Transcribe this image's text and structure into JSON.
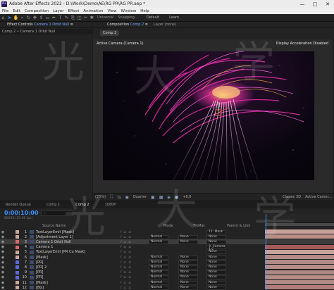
{
  "window": {
    "title": "Adobe After Effects 2022 - D:\\Work\\Demo\\AE\\RG PR\\RG PR.aep *",
    "app_icon": "Ae",
    "controls": [
      "—",
      "□",
      "✕"
    ]
  },
  "menu": [
    "File",
    "Edit",
    "Composition",
    "Layer",
    "Effect",
    "Animation",
    "View",
    "Window",
    "Help"
  ],
  "toolbar": {
    "tools": [
      "home-icon",
      "select-icon",
      "hand-icon",
      "zoom-icon",
      "orbit-icon",
      "pan-icon",
      "dolly-icon",
      "rectangle-icon",
      "pen-icon",
      "text-icon",
      "brush-icon",
      "clone-icon",
      "eraser-icon",
      "roto-icon",
      "puppet-icon"
    ],
    "universal_label": "Universal",
    "snapping_label": "Snapping",
    "workspaces": [
      "Default",
      "Learn"
    ]
  },
  "left_panel": {
    "tab_prefix": "Effect Controls",
    "tab_layer": "Camera 1 Orbit Null",
    "tab_menu": "≡",
    "header": "Comp 2 • Camera 1 Orbit Null"
  },
  "comp_panel": {
    "tab": "Composition",
    "tab_comp": "Comp 2",
    "tab_menu": "≡",
    "layer_tab": "Layer  (none)",
    "subtab": "Comp 2",
    "active_camera": "Active Camera (Camera 1)",
    "display_accel": "Display Acceleration Disabled"
  },
  "viewer_bar": {
    "zoom": "(25%)",
    "resolution": "Quarter",
    "plus_value": "+0.0",
    "renderer": "Classic 3D",
    "view": "Active Camer..."
  },
  "timeline": {
    "tabs": [
      "Render Queue",
      "Comp 1",
      "Comp 2",
      "1080P"
    ],
    "active_tab": "Comp 2",
    "timecode": "0:00:10:00",
    "frames": "00250 (25.00 fps)",
    "columns": {
      "source_name": "Source Name",
      "mode": "Mode",
      "trkmat": "TrkMat",
      "parent": "Parent & Link"
    },
    "layers": [
      {
        "num": "1",
        "name": "TextLayerEmit [Mask]",
        "color": "#c9a7a0",
        "mode": "",
        "trk": "",
        "parent": "11. Mask",
        "selected": false
      },
      {
        "num": "2",
        "name": "[Adjustment Layer 1]",
        "color": "#c9a7a0",
        "mode": "Normal",
        "trk": "None",
        "parent": "None",
        "selected": false
      },
      {
        "num": "3",
        "name": "Camera 1 Orbit Null",
        "color": "#d96a6a",
        "mode": "Normal",
        "trk": "None",
        "parent": "None",
        "selected": true
      },
      {
        "num": "4",
        "name": "Camera 1",
        "color": "#d96a6a",
        "mode": "",
        "trk": "",
        "parent": "3. Camera 1 C",
        "selected": false
      },
      {
        "num": "5",
        "name": "TextLayerEmit [PR Cu Mask]",
        "color": "#c9a7a0",
        "mode": "",
        "trk": "",
        "parent": "None",
        "selected": false
      },
      {
        "num": "6",
        "name": "[Mask]",
        "color": "#c9a7a0",
        "mode": "Normal",
        "trk": "None",
        "parent": "None",
        "selected": false
      },
      {
        "num": "7",
        "name": "[PR]",
        "color": "#5a6ad9",
        "mode": "Normal",
        "trk": "None",
        "parent": "None",
        "selected": false
      },
      {
        "num": "8",
        "name": "[PR] 2",
        "color": "#5a6ad9",
        "mode": "Normal",
        "trk": "None",
        "parent": "None",
        "selected": false
      },
      {
        "num": "9",
        "name": "[PR]",
        "color": "#5a6ad9",
        "mode": "Normal",
        "trk": "None",
        "parent": "None",
        "selected": false
      },
      {
        "num": "10",
        "name": "[PR]",
        "color": "#5a6ad9",
        "mode": "Normal",
        "trk": "None",
        "parent": "None",
        "selected": false
      },
      {
        "num": "11",
        "name": "[Mask]",
        "color": "#c9a7a0",
        "mode": "Normal",
        "trk": "None",
        "parent": "None",
        "selected": false
      },
      {
        "num": "12",
        "name": "[BG]",
        "color": "#c9a7a0",
        "mode": "Normal",
        "trk": "None",
        "parent": "None",
        "selected": false
      }
    ],
    "bar_colors": [
      "#c8a19a",
      "#b98f88",
      "#9a6a6a",
      "#a75a5a",
      "#c7a29b",
      "#b38a84",
      "#b08a86",
      "#b68e88",
      "#ad8983",
      "#b68e88",
      "#b38a84",
      "#b07d7a"
    ]
  },
  "watermark": [
    "光",
    "大",
    "学",
    "光",
    "大",
    "学"
  ],
  "colors": {
    "accent": "#3a8fff",
    "panel": "#232323",
    "selected_row": "#3d3d3d"
  }
}
